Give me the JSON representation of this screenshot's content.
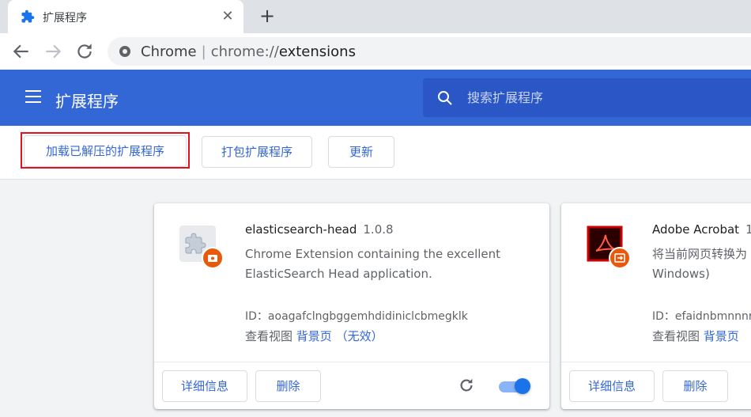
{
  "tab": {
    "title": "扩展程序",
    "close": "✕"
  },
  "toolbar": {
    "new_tab": "+",
    "omnibox": {
      "site": "Chrome",
      "scheme": "chrome://",
      "path": "extensions"
    }
  },
  "header": {
    "title": "扩展程序",
    "search_placeholder": "搜索扩展程序"
  },
  "devbar": {
    "load_unpacked": "加载已解压的扩展程序",
    "pack": "打包扩展程序",
    "update": "更新"
  },
  "cards": [
    {
      "name": "elasticsearch-head",
      "version": "1.0.8",
      "description": "Chrome Extension containing the excellent ElasticSearch Head application.",
      "id_label": "ID：",
      "id": "aoagafclngbggemhdidiniclcbmegklk",
      "views_label": "查看视图",
      "views_link": "背景页",
      "views_status": "（无效）",
      "details": "详细信息",
      "remove": "删除",
      "enabled": true
    },
    {
      "name": "Adobe Acrobat",
      "version": "1",
      "description": "将当前网页转换为 Windows)",
      "id_label": "ID：",
      "id": "efaidnbmnnnn",
      "views_label": "查看视图",
      "views_link": "背景页",
      "details": "详细信息",
      "remove": "删除"
    }
  ],
  "colors": {
    "header_bg": "#3367d6",
    "accent": "#3367d6",
    "highlight": "#e3121e"
  }
}
